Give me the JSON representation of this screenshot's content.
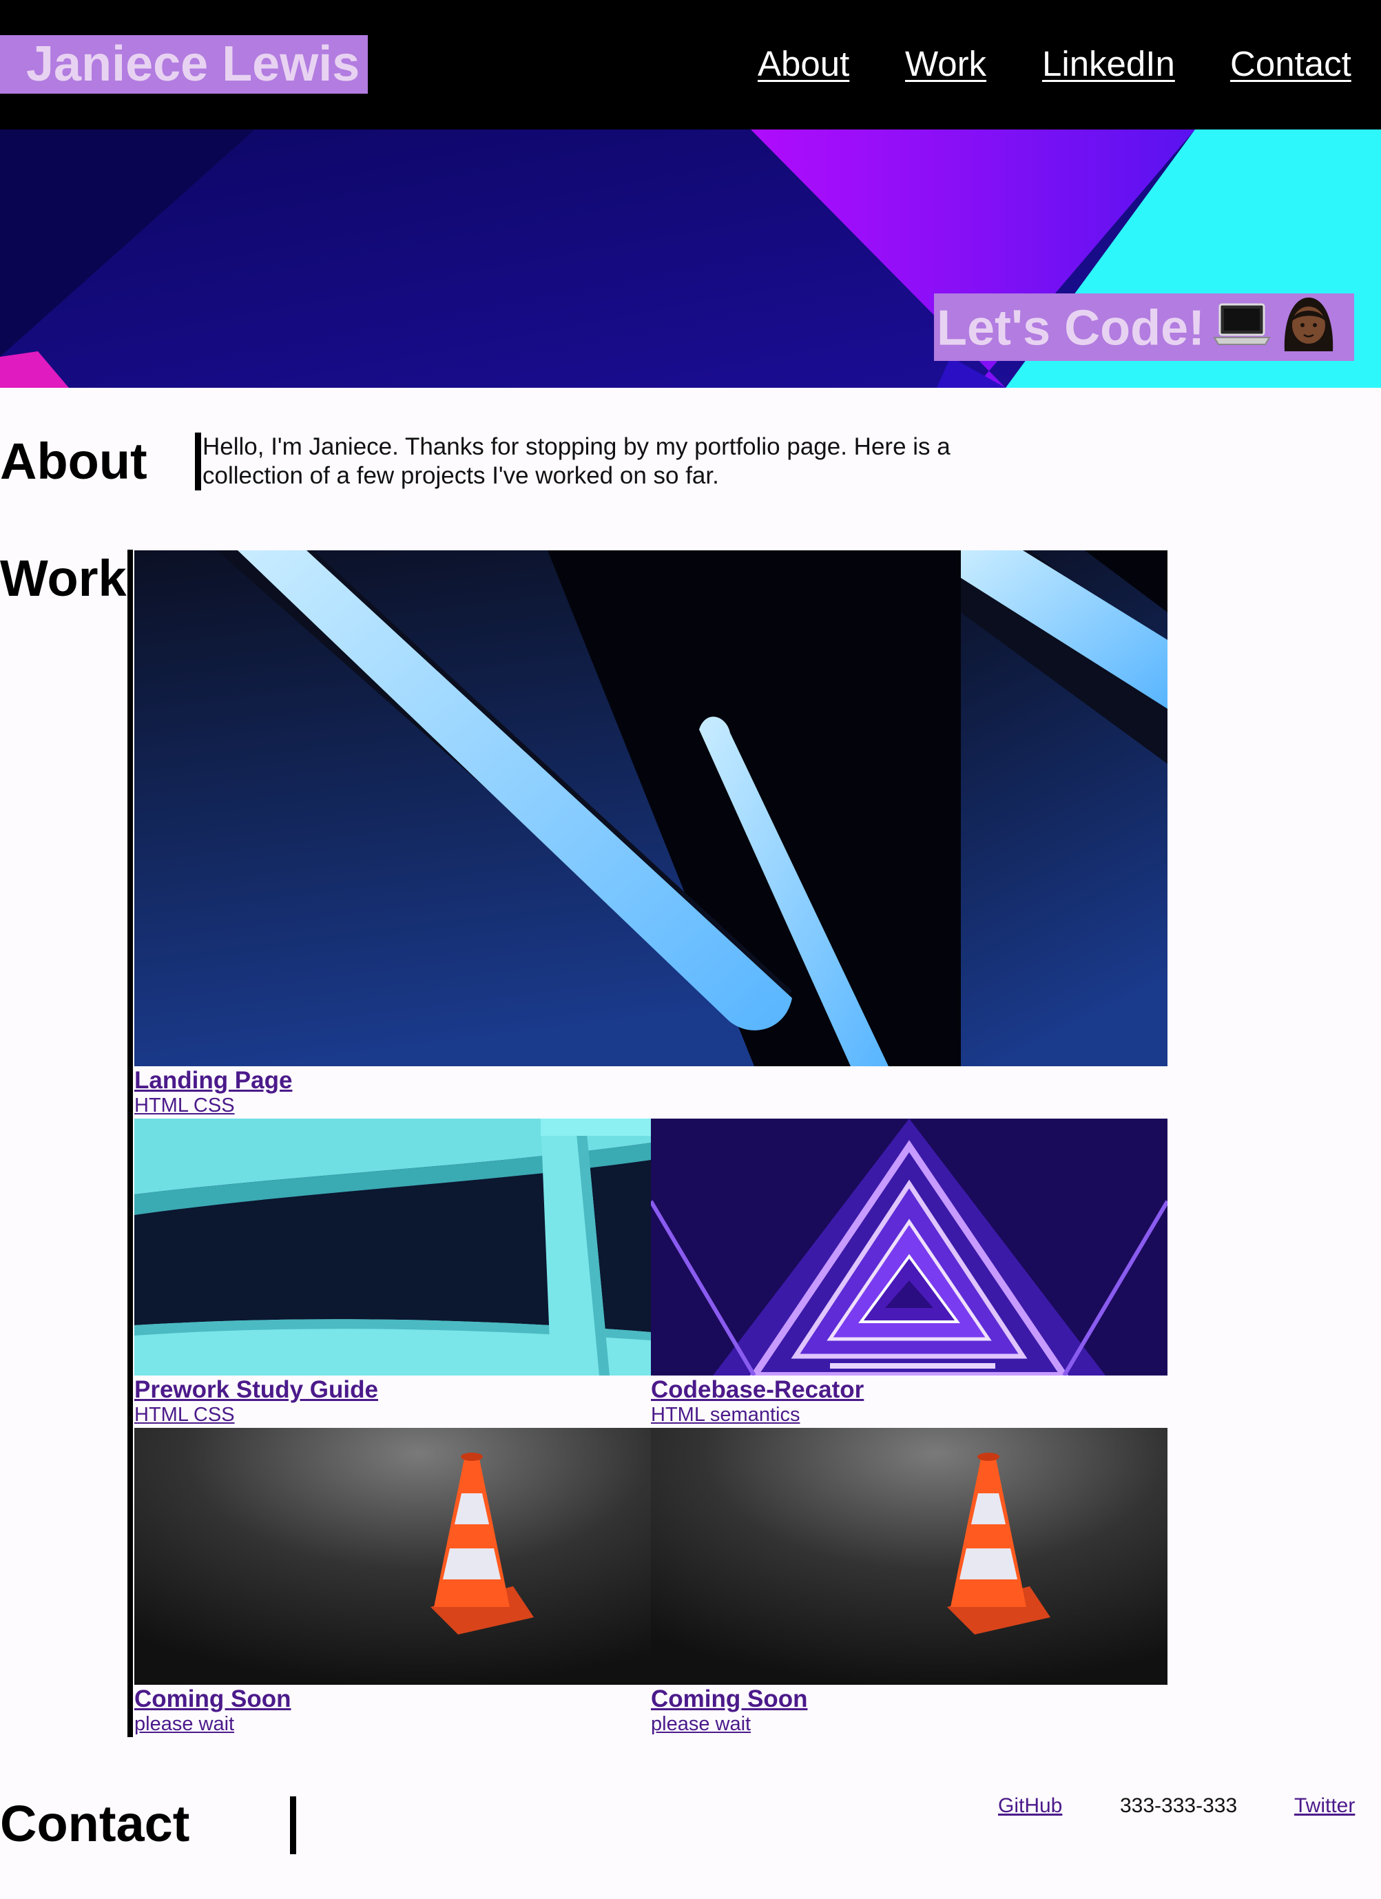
{
  "header": {
    "brand": "Janiece Lewis",
    "nav": [
      "About",
      "Work",
      "LinkedIn",
      "Contact"
    ]
  },
  "hero": {
    "tagline": "Let's Code!",
    "icons": [
      "laptop-icon",
      "woman-icon"
    ]
  },
  "about": {
    "title": "About",
    "text": "Hello, I'm Janiece. Thanks for stopping by my portfolio page. Here is a collection of a few projects I've worked on so far."
  },
  "work": {
    "title": "Work",
    "projects": [
      {
        "title": "Landing Page",
        "tags": "HTML CSS",
        "image": "neon-tubes"
      },
      {
        "title": "Prework Study Guide",
        "tags": "HTML CSS",
        "image": "teal-structure"
      },
      {
        "title": "Codebase-Recator",
        "tags": "HTML semantics",
        "image": "purple-triangle-stairs"
      },
      {
        "title": "Coming Soon",
        "tags": "please wait",
        "image": "traffic-cone"
      },
      {
        "title": "Coming Soon",
        "tags": "please wait",
        "image": "traffic-cone"
      }
    ]
  },
  "contact": {
    "title": "Contact",
    "links": [
      "GitHub",
      "333-333-333",
      "Twitter"
    ]
  },
  "colors": {
    "brand_bg": "#b27ce0",
    "brand_text": "#e8d2f2",
    "link": "#4b1a8a",
    "hero_navy": "#1b0f95",
    "hero_cyan": "#2ef7fb",
    "hero_purple": "#b20dfc"
  }
}
